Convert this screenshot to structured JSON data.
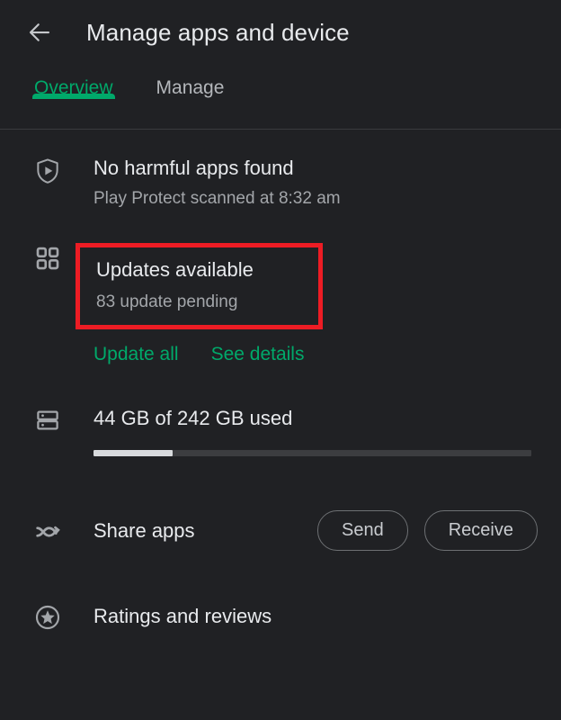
{
  "appbar": {
    "back_icon": "arrow-left-icon",
    "title": "Manage apps and device"
  },
  "tabs": [
    {
      "label": "Overview",
      "active": true
    },
    {
      "label": "Manage",
      "active": false
    }
  ],
  "colors": {
    "background": "#202124",
    "accent_green": "#00a96a",
    "annotation_red": "#ed1c24",
    "primary_text": "#e8eaed",
    "secondary_text": "#a3a6aa"
  },
  "rows": {
    "play_protect": {
      "icon": "shield-play-icon",
      "title": "No harmful apps found",
      "subtitle": "Play Protect scanned at 8:32 am"
    },
    "updates": {
      "icon": "apps-grid-icon",
      "title": "Updates available",
      "subtitle": "83 update pending",
      "annotated": true,
      "actions": [
        {
          "label": "Update all"
        },
        {
          "label": "See details"
        }
      ]
    },
    "storage": {
      "icon": "storage-icon",
      "title": "44 GB of 242 GB used",
      "used_gb": 44,
      "total_gb": 242,
      "percent_used": 18
    },
    "share": {
      "icon": "nearby-share-icon",
      "label": "Share apps",
      "buttons": [
        {
          "label": "Send"
        },
        {
          "label": "Receive"
        }
      ]
    },
    "ratings": {
      "icon": "star-circle-icon",
      "title": "Ratings and reviews"
    }
  }
}
